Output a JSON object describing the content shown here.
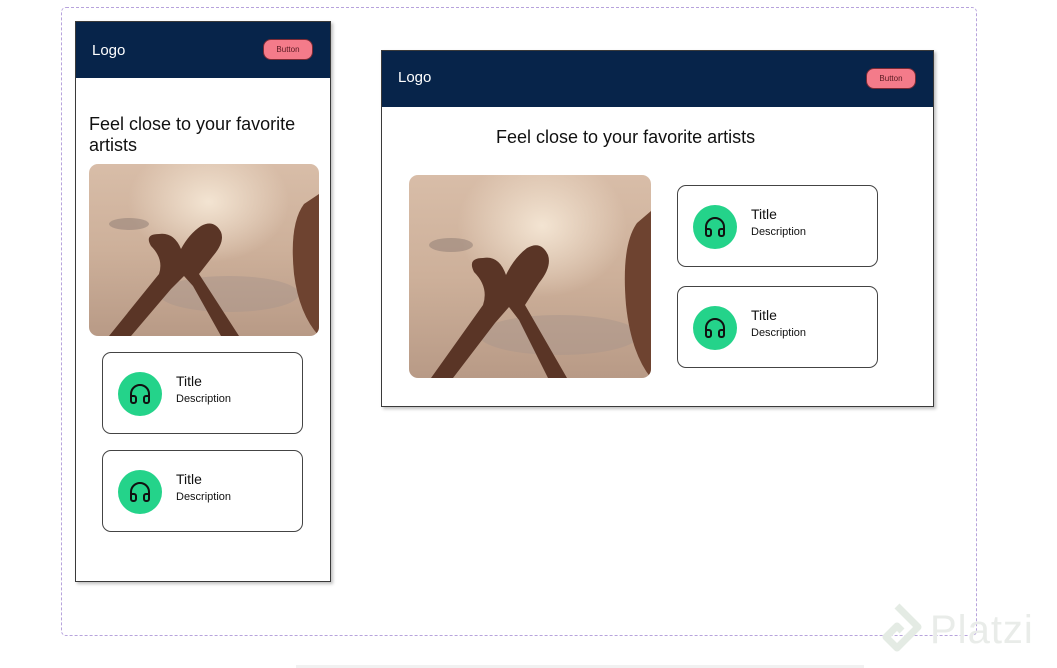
{
  "mobile": {
    "logo": "Logo",
    "button_label": "Button",
    "hero_title": "Feel close to your favorite artists",
    "cards": [
      {
        "title": "Title",
        "description": "Description",
        "icon": "headphones-icon"
      },
      {
        "title": "Title",
        "description": "Description",
        "icon": "headphones-icon"
      }
    ]
  },
  "desktop": {
    "logo": "Logo",
    "button_label": "Button",
    "hero_title": "Feel close to your favorite artists",
    "cards": [
      {
        "title": "Title",
        "description": "Description",
        "icon": "headphones-icon"
      },
      {
        "title": "Title",
        "description": "Description",
        "icon": "headphones-icon"
      }
    ]
  },
  "watermark": {
    "text": "Platzi"
  },
  "colors": {
    "navbar": "#07244a",
    "button": "#f47b8a",
    "icon_circle": "#24d38a",
    "canvas_border": "#b7a3dc"
  }
}
